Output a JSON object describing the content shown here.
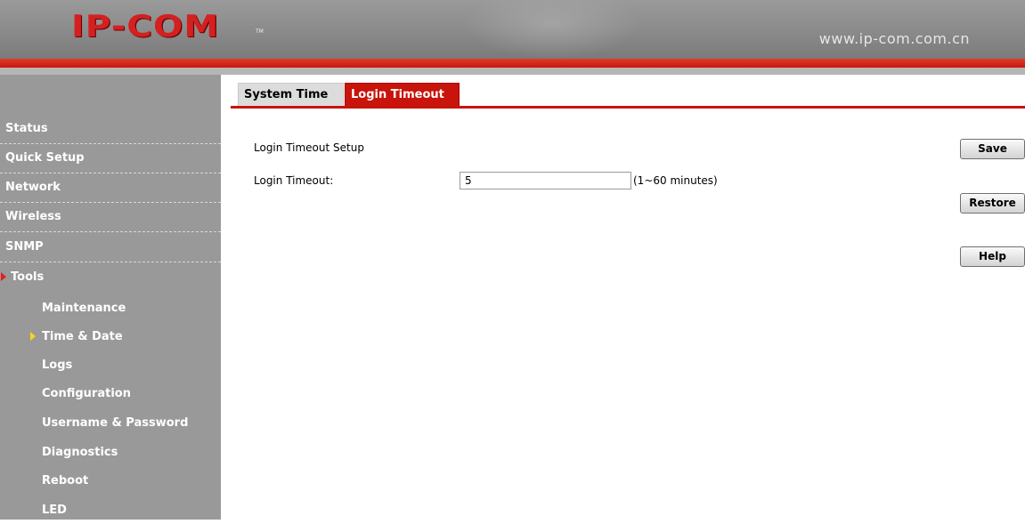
{
  "header": {
    "logo_text": "IP-COM",
    "logo_tm": "TM",
    "url": "www.ip-com.com.cn"
  },
  "sidebar": {
    "items": [
      {
        "label": "Status"
      },
      {
        "label": "Quick Setup"
      },
      {
        "label": "Network"
      },
      {
        "label": "Wireless"
      },
      {
        "label": "SNMP"
      },
      {
        "label": "Tools",
        "active": true
      }
    ],
    "tools_submenu": [
      {
        "label": "Maintenance"
      },
      {
        "label": "Time & Date",
        "active": true
      },
      {
        "label": "Logs"
      },
      {
        "label": "Configuration"
      },
      {
        "label": "Username & Password"
      },
      {
        "label": "Diagnostics"
      },
      {
        "label": "Reboot"
      },
      {
        "label": "LED"
      }
    ]
  },
  "tabs": [
    {
      "label": "System Time",
      "active": false
    },
    {
      "label": "Login Timeout",
      "active": true
    }
  ],
  "form": {
    "section_title": "Login Timeout Setup",
    "timeout_label": "Login Timeout:",
    "timeout_value": "5",
    "timeout_hint": "(1~60 minutes)"
  },
  "buttons": {
    "save": "Save",
    "restore": "Restore",
    "help": "Help"
  },
  "colors": {
    "brand_red": "#c8140a",
    "sidebar_bg": "#999999",
    "active_arrow_main": "#e02020",
    "active_arrow_sub": "#ffd21a"
  }
}
